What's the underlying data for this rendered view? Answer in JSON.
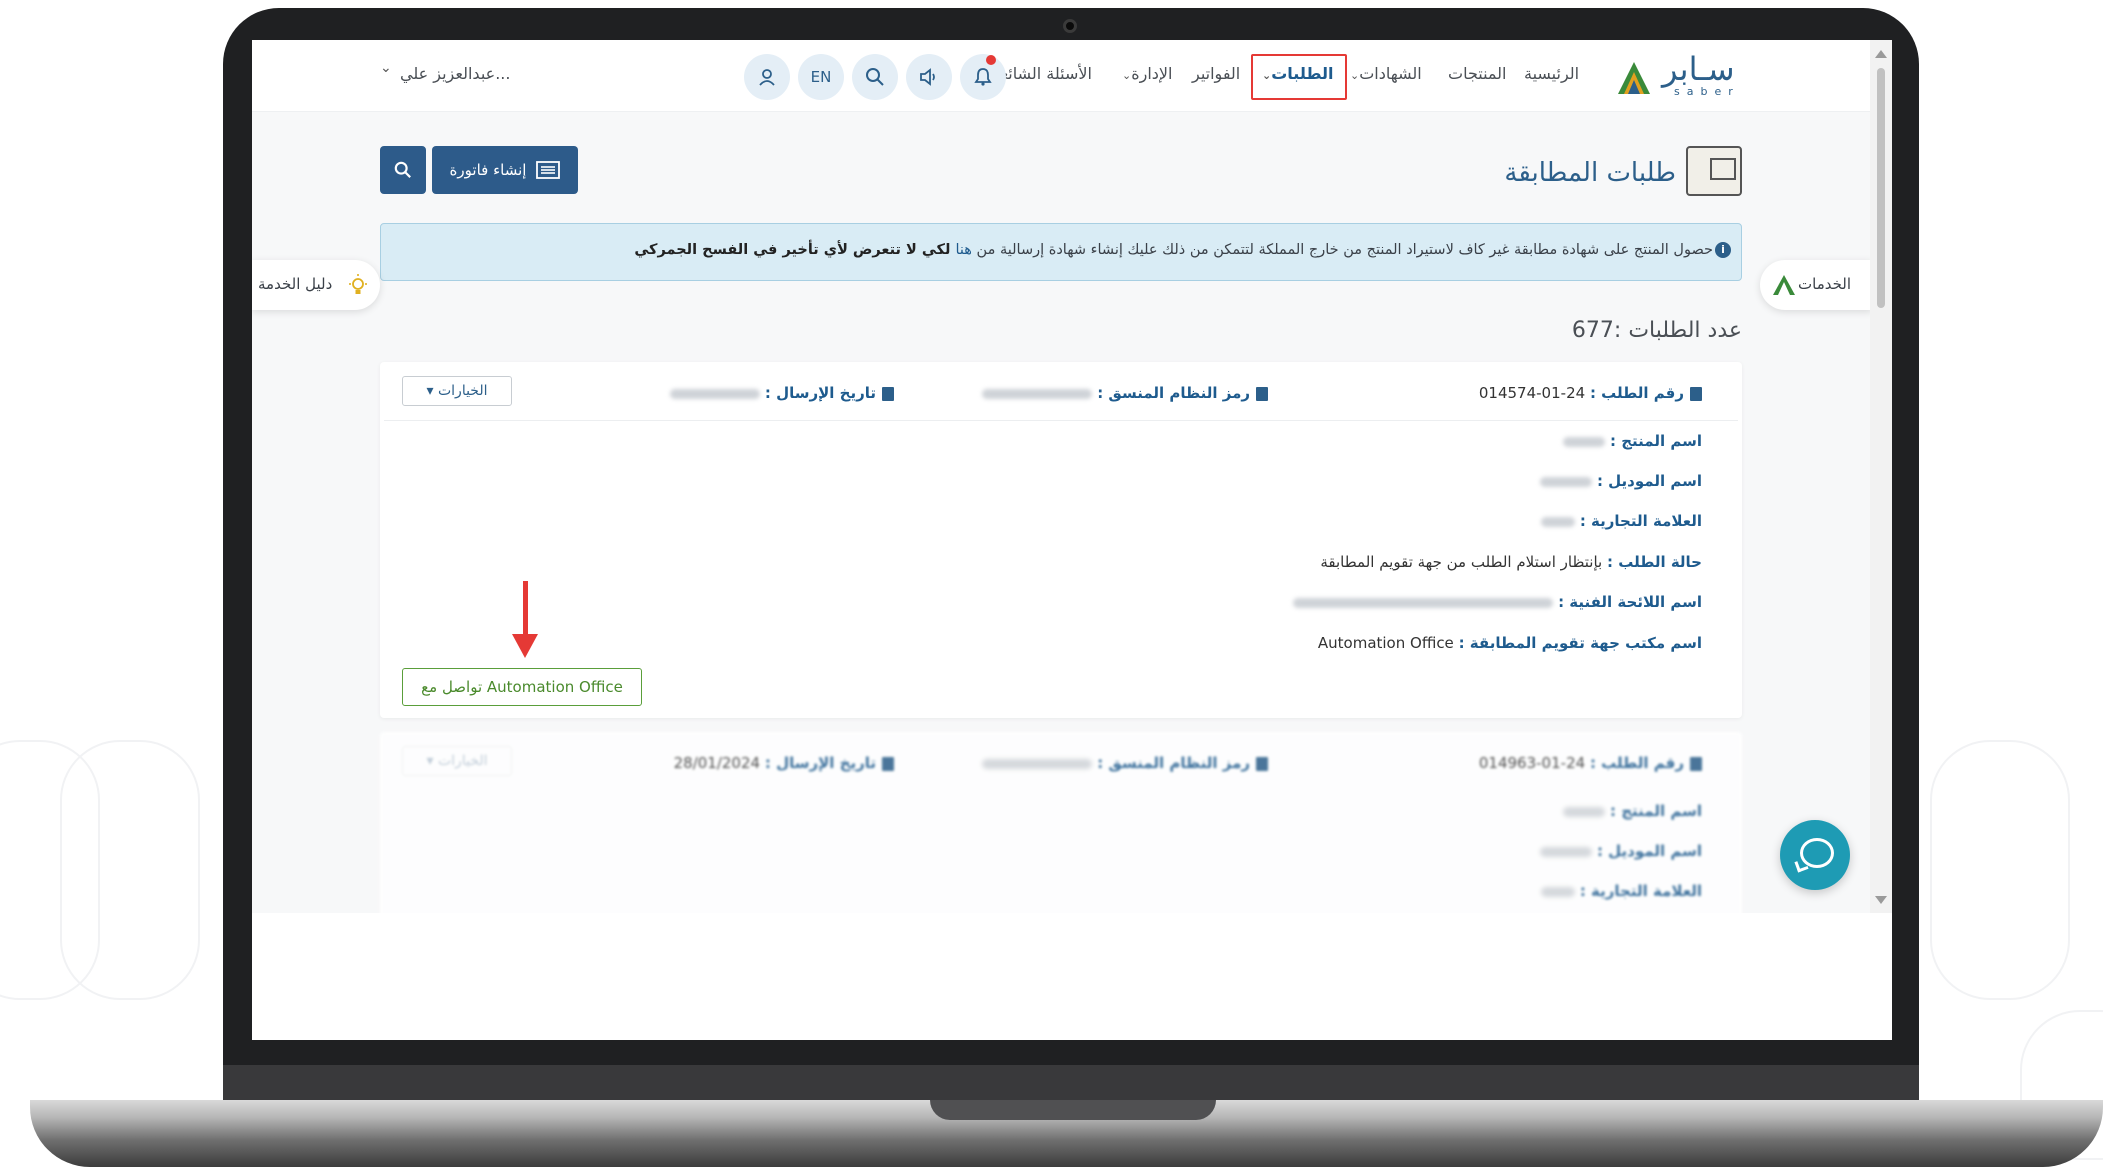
{
  "nav": {
    "home": "الرئيسية",
    "products": "المنتجات",
    "certificates": "الشهادات",
    "requests": "الطلبات",
    "invoices": "الفواتير",
    "admin": "الإدارة",
    "faq": "الأسئلة الشائعة",
    "lang": "EN",
    "user": "عبدالعزيز علي..."
  },
  "logo": {
    "word": "سـابر",
    "sub": "saber"
  },
  "page": {
    "title": "طلبات المطابقة",
    "create_invoice": "إنشاء فاتورة",
    "count": "عدد الطلبات :677"
  },
  "alert": {
    "text_a": "حصول المنتج على شهادة مطابقة غير كاف لاستيراد المنتج من خارج المملكة لتتمكن من ذلك عليك إنشاء شهادة إرسالية من ",
    "link": "هنا",
    "text_b": " لكي لا تتعرض لأي تأخير في الفسح الجمركي"
  },
  "side_tabs": {
    "services": "الخدمات",
    "guide": "دليل الخدمة"
  },
  "card": {
    "request_no_label": "رقم الطلب :",
    "request_no": "24-01-014574",
    "hs_code_label": "رمز النظام المنسق :",
    "send_date_label": "تاريخ الإرسال :",
    "options": "الخيارات",
    "product_name_label": "اسم المنتج :",
    "model_name_label": "اسم الموديل :",
    "brand_label": "العلامة التجارية :",
    "status_label": "حالة الطلب :",
    "status_value": "بإنتظار استلام الطلب من جهة تقويم المطابقة",
    "regulation_label": "اسم اللائحة الفنية :",
    "office_label": "اسم مكتب جهة تقويم المطابقة :",
    "office_value": "Automation Office",
    "contact_button": "تواصل مع Automation Office"
  },
  "card2": {
    "request_no": "24-01-014963",
    "send_date": "28/01/2024"
  }
}
